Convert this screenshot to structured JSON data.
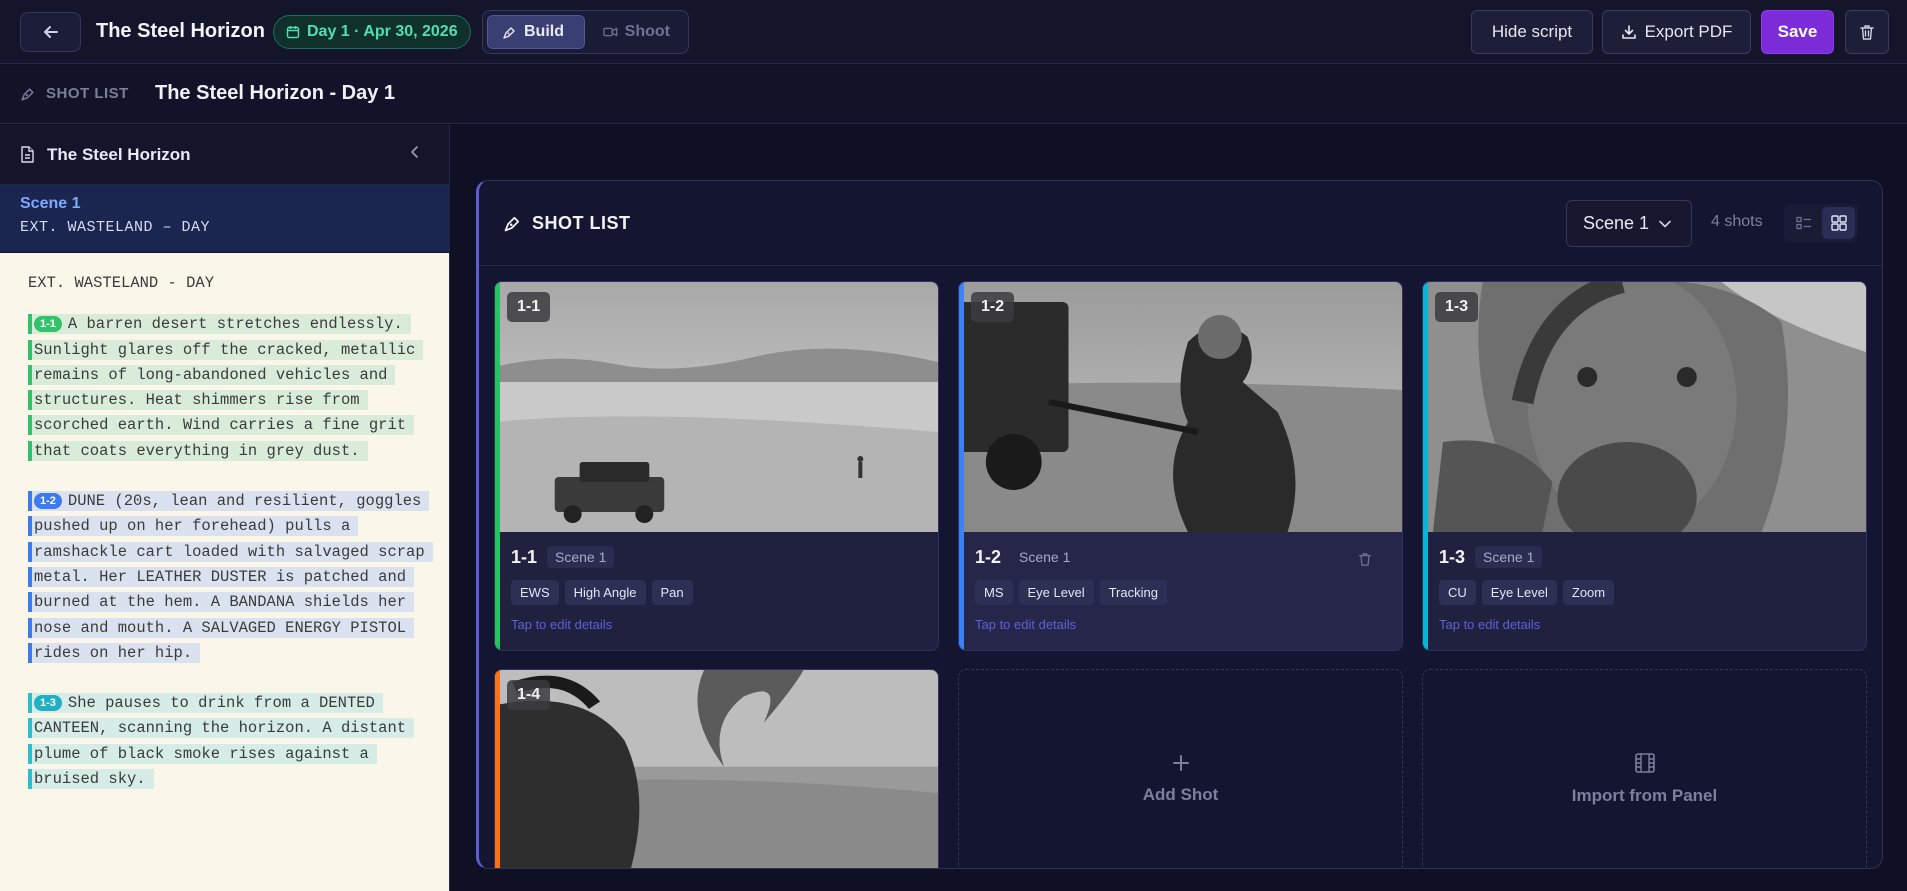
{
  "header": {
    "back_icon": "arrow-left-icon",
    "project_title": "The Steel Horizon",
    "day_badge": "Day 1 · Apr 30, 2026",
    "modes": [
      {
        "label": "Build",
        "icon": "pen-tool-icon",
        "active": true
      },
      {
        "label": "Shoot",
        "icon": "video-camera-icon",
        "active": false
      }
    ],
    "hide_script": "Hide script",
    "export_pdf": "Export PDF",
    "save": "Save",
    "delete_icon": "trash-icon"
  },
  "subheader": {
    "label": "SHOT LIST",
    "title": "The Steel Horizon - Day 1"
  },
  "sidebar": {
    "title": "The Steel Horizon",
    "scene_label": "Scene 1",
    "scene_heading": "EXT. WASTELAND – DAY",
    "script": {
      "slugline": "EXT. WASTELAND - DAY",
      "blocks": [
        {
          "tag": "1-1",
          "text": "A barren desert stretches endlessly. Sunlight glares off the cracked, metallic remains of long-abandoned vehicles and structures. Heat shimmers rise from scorched earth. Wind carries a fine grit that coats everything in grey dust."
        },
        {
          "tag": "1-2",
          "text": "DUNE (20s, lean and resilient, goggles pushed up on her forehead) pulls a ramshackle cart loaded with salvaged scrap metal. Her LEATHER DUSTER is patched and burned at the hem. A BANDANA shields her nose and mouth. A SALVAGED ENERGY PISTOL rides on her hip."
        },
        {
          "tag": "1-3",
          "text": "She pauses to drink from a DENTED CANTEEN, scanning the horizon. A distant plume of black smoke rises against a bruised sky."
        }
      ]
    }
  },
  "shot_list": {
    "title": "SHOT LIST",
    "scene_select": "Scene 1",
    "shot_count": "4 shots",
    "cards": [
      {
        "id": "1-1",
        "scene": "Scene 1",
        "tags": [
          "EWS",
          "High Angle",
          "Pan"
        ],
        "edit_hint": "Tap to edit details",
        "color": "#22c55e"
      },
      {
        "id": "1-2",
        "scene": "Scene 1",
        "tags": [
          "MS",
          "Eye Level",
          "Tracking"
        ],
        "edit_hint": "Tap to edit details",
        "color": "#3b82f6"
      },
      {
        "id": "1-3",
        "scene": "Scene 1",
        "tags": [
          "CU",
          "Eye Level",
          "Zoom"
        ],
        "edit_hint": "Tap to edit details",
        "color": "#06b6d4"
      },
      {
        "id": "1-4",
        "color": "#f97316"
      }
    ],
    "add_shot": "Add Shot",
    "import_panel": "Import from Panel"
  }
}
